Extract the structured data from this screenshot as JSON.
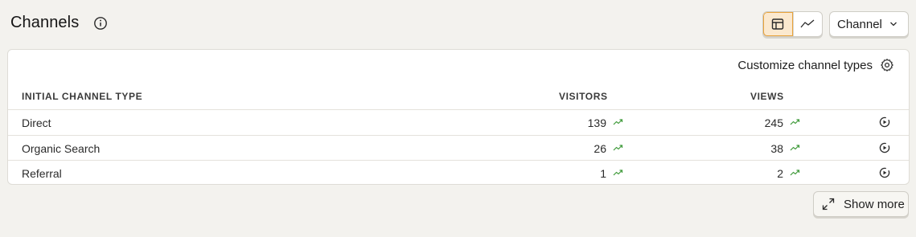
{
  "header": {
    "title": "Channels",
    "view_toggle": {
      "selected": "table"
    },
    "breakdown_dropdown": "Channel"
  },
  "card": {
    "customize_label": "Customize channel types",
    "columns": {
      "type": "INITIAL CHANNEL TYPE",
      "visitors": "VISITORS",
      "views": "VIEWS"
    },
    "rows": [
      {
        "label": "Direct",
        "visitors": "139",
        "views": "245"
      },
      {
        "label": "Organic Search",
        "visitors": "26",
        "views": "38"
      },
      {
        "label": "Referral",
        "visitors": "1",
        "views": "2"
      }
    ]
  },
  "show_more_label": "Show more",
  "colors": {
    "accent": "#e8a33a",
    "trend_up": "#3f9a3a"
  }
}
